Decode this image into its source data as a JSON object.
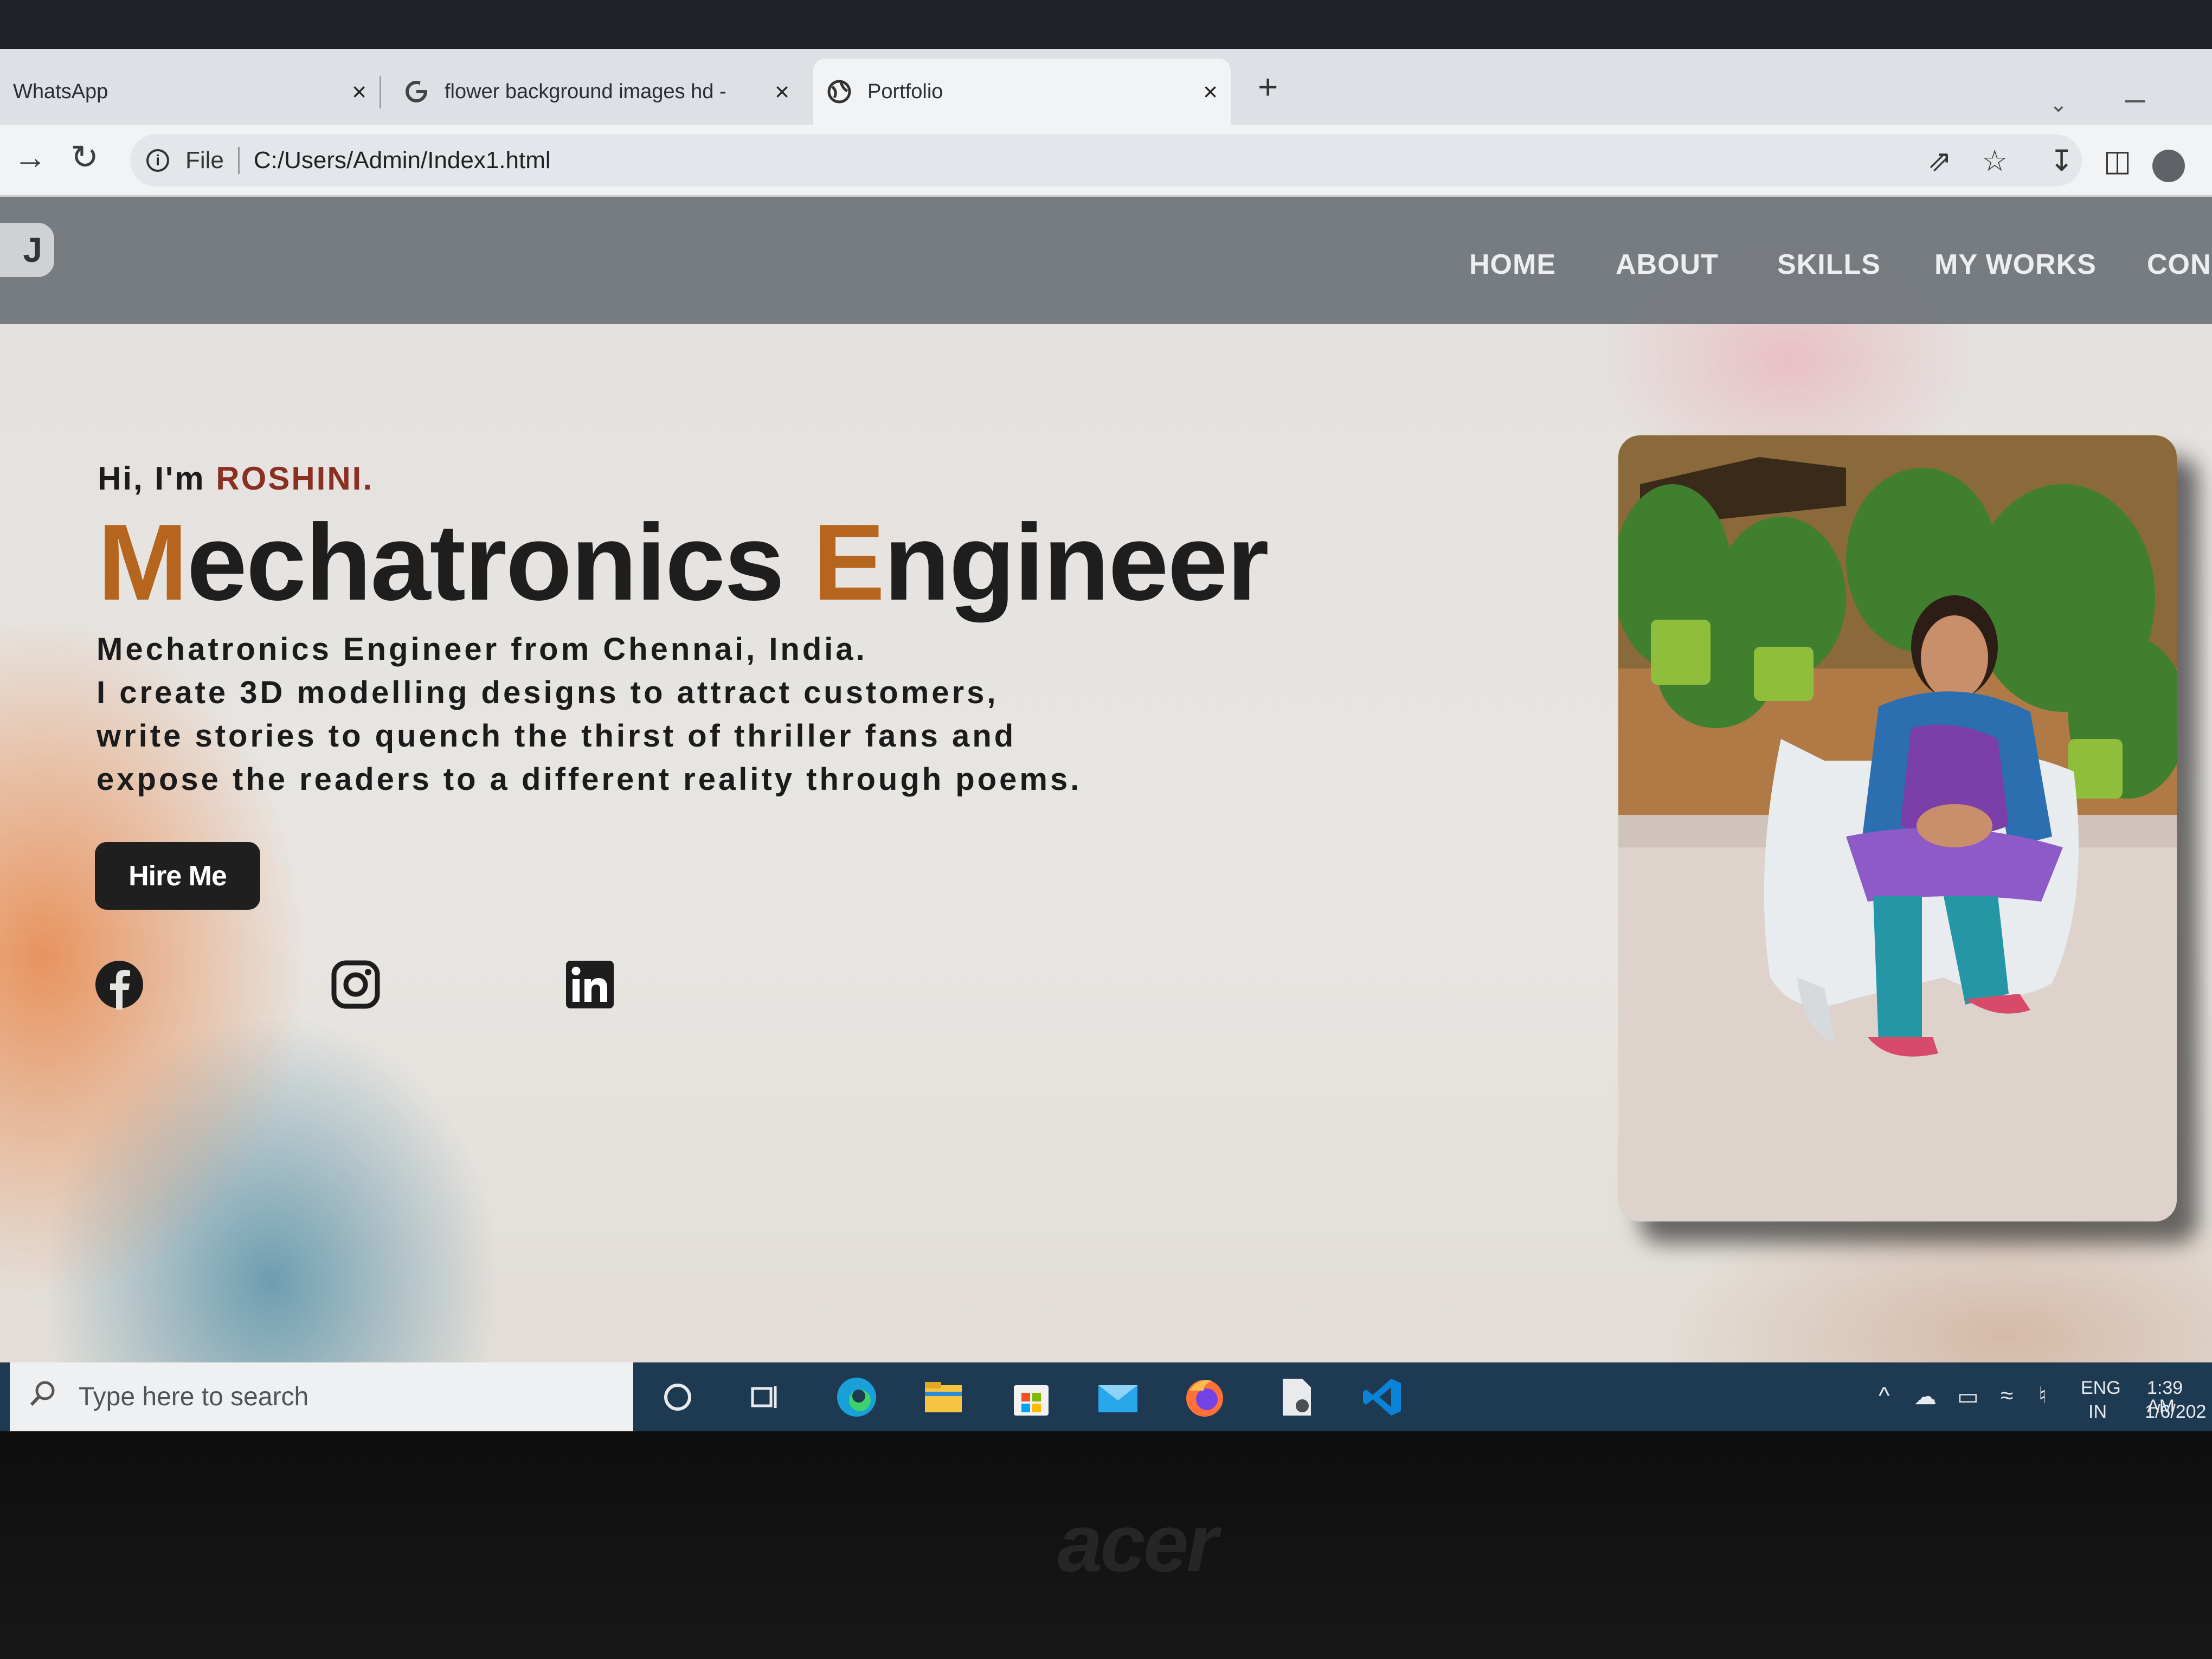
{
  "browser": {
    "tabs": [
      {
        "title": "WhatsApp",
        "close": "×",
        "active": false
      },
      {
        "title": "flower background images hd -",
        "close": "×",
        "active": false
      },
      {
        "title": "Portfolio",
        "close": "×",
        "active": true
      }
    ],
    "new_tab": "+",
    "address": {
      "scheme": "File",
      "url": "C:/Users/Admin/Index1.html"
    }
  },
  "site": {
    "logo": "J",
    "nav": [
      "HOME",
      "ABOUT",
      "SKILLS",
      "MY WORKS",
      "CON"
    ],
    "greeting_prefix": "Hi, I'm ",
    "greeting_name": "ROSHINI.",
    "headline": {
      "part1_first": "M",
      "part1_rest": "echatronics ",
      "part2_first": "E",
      "part2_rest": "ngineer"
    },
    "bio_lines": [
      "Mechatronics Engineer from Chennai, India.",
      "I create 3D modelling designs to attract customers,",
      "write stories to quench the thirst of thriller fans and",
      "expose the readers to a different reality through poems."
    ],
    "hire_button": "Hire Me",
    "social_icons": [
      "facebook-icon",
      "instagram-icon",
      "linkedin-icon"
    ],
    "colors": {
      "name": "#8a2f22",
      "accent": "#b5651d",
      "button": "#1f1f1f"
    }
  },
  "taskbar": {
    "search_placeholder": "Type here to search",
    "lang_top": "ENG",
    "lang_bottom": "IN",
    "time": "1:39 AM",
    "date": "1/6/202"
  },
  "device": {
    "brand": "acer"
  }
}
